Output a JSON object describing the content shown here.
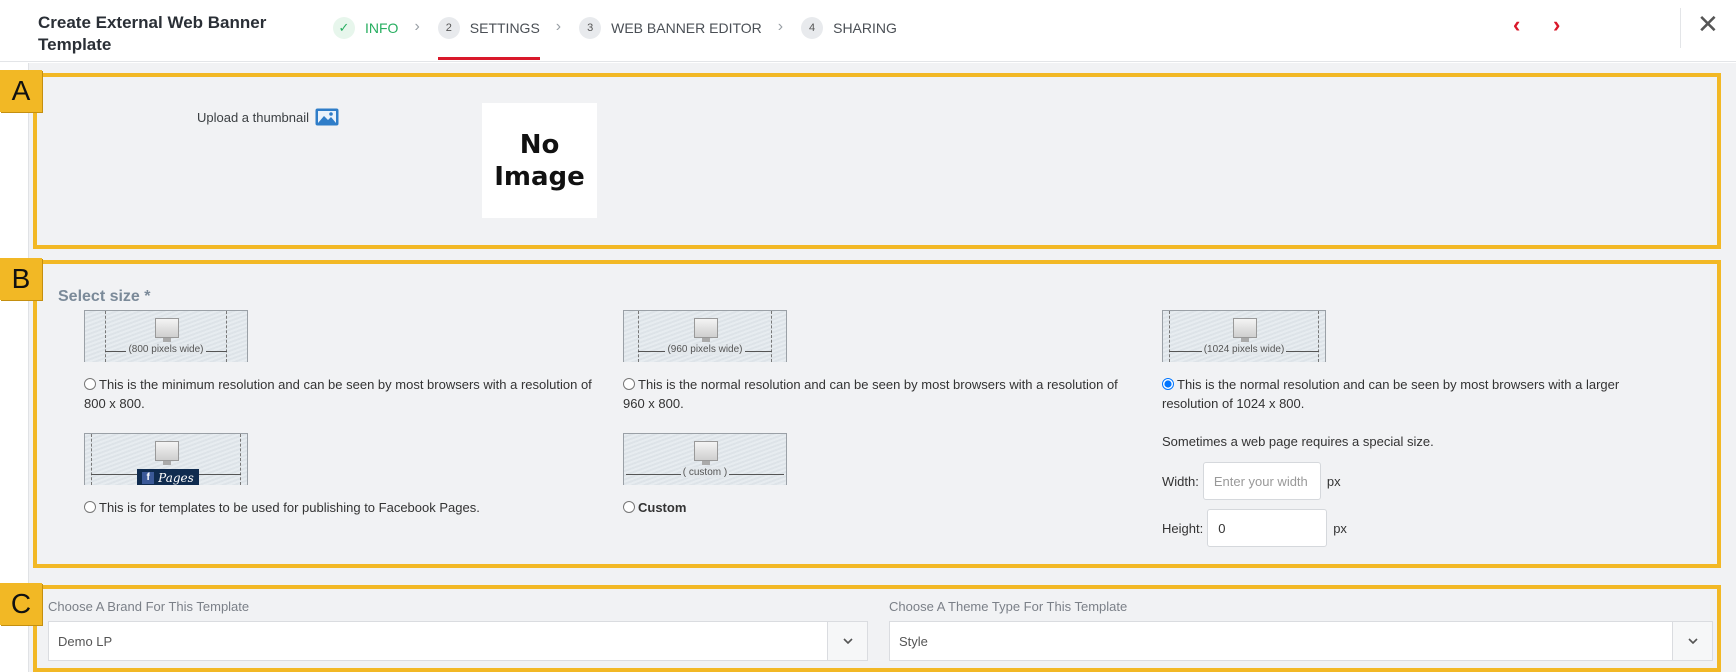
{
  "header": {
    "title": "Create External Web Banner Template",
    "steps": [
      {
        "num": "✓",
        "label": "INFO",
        "state": "done"
      },
      {
        "num": "2",
        "label": "SETTINGS",
        "state": "active"
      },
      {
        "num": "3",
        "label": "WEB BANNER EDITOR",
        "state": "pending"
      },
      {
        "num": "4",
        "label": "SHARING",
        "state": "pending"
      }
    ],
    "prev_icon": "‹",
    "next_icon": "›",
    "close_icon": "✕"
  },
  "annotations": {
    "a": "A",
    "b": "B",
    "c": "C"
  },
  "panel_a": {
    "upload_label": "Upload a thumbnail",
    "no_image_line1": "No",
    "no_image_line2": "Image"
  },
  "panel_b": {
    "select_size_label": "Select size *",
    "sizes": [
      {
        "caption": "(800 pixels wide)",
        "text": "This is the minimum resolution and can be seen by most browsers with a resolution of 800 x 800.",
        "selected": false
      },
      {
        "caption": "(960 pixels wide)",
        "text": "This is the normal resolution and can be seen by most browsers with a resolution of 960 x 800.",
        "selected": false
      },
      {
        "caption": "(1024 pixels wide)",
        "text": "This is the normal resolution and can be seen by most browsers with a larger resolution of 1024 x 800.",
        "selected": true
      },
      {
        "caption": "Pages",
        "text": "This is for templates to be used for publishing to Facebook Pages.",
        "selected": false
      },
      {
        "caption": "( custom )",
        "text": "Custom",
        "selected": false
      }
    ],
    "special_size_text": "Sometimes a web page requires a special size.",
    "width_label": "Width:",
    "width_placeholder": "Enter your width",
    "width_unit": "px",
    "height_label": "Height:",
    "height_value": "0",
    "height_unit": "px"
  },
  "panel_c": {
    "brand_label": "Choose A Brand For This Template",
    "brand_value": "Demo LP",
    "theme_label": "Choose A Theme Type For This Template",
    "theme_value": "Style"
  },
  "colors": {
    "accent": "#d9182a",
    "done": "#27ae60",
    "annotation": "#f2b825"
  }
}
